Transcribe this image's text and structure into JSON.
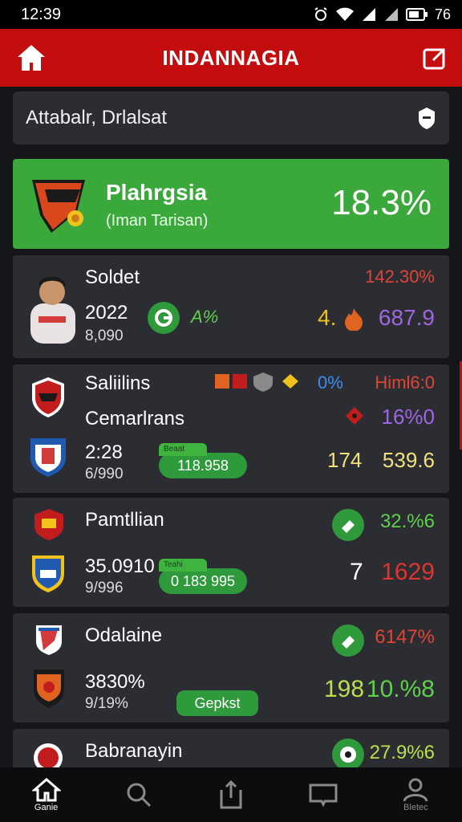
{
  "status_bar": {
    "time": "12:39",
    "battery": "76"
  },
  "app_bar": {
    "title": "INDANNAGIA"
  },
  "search": {
    "text": "Attabalr, Drlalsat"
  },
  "featured": {
    "name": "Plahrgsia",
    "subtitle": "(Iman Tarisan)",
    "percent": "18.3%"
  },
  "cards": [
    {
      "name": "Soldet",
      "top_right": "142.30%",
      "value": "2022",
      "sub": "8,090",
      "mid_label": "A%",
      "right_a": "4.",
      "right_b": "687.9",
      "colors": {
        "top_right": "#e04535",
        "right_a": "#f2c21c",
        "right_b": "#a066e0"
      }
    },
    {
      "name": "Saliilins",
      "name2": "Cemarlrans",
      "top_pct": "0%",
      "top_right": "Himl6:0",
      "mid_right": "16%0",
      "value": "2:28",
      "sub": "6/990",
      "pill": "118.958",
      "pill_tab": "Beaat",
      "right_a": "174",
      "right_b": "539.6",
      "colors": {
        "top_pct": "#3a8ef0",
        "top_right": "#e04535",
        "mid_right": "#a066e0",
        "right_a": "#f2e17a",
        "right_b": "#f2e17a"
      }
    },
    {
      "name": "Pamtllian",
      "top_right": "32.%6",
      "value": "35.0910",
      "sub": "9/996",
      "pill": "0 183 995",
      "pill_tab": "Teahi",
      "right_a": "7",
      "right_b": "1629",
      "colors": {
        "top_right": "#5fd04a",
        "right_a": "#ffffff",
        "right_b": "#e0342e"
      }
    },
    {
      "name": "Odalaine",
      "top_right": "6147%",
      "value": "3830%",
      "sub": "9/19%",
      "pill": "Gepkst",
      "right_a": "198",
      "right_b": "10.%8",
      "colors": {
        "top_right": "#e04535",
        "right_a": "#b9e04a",
        "right_b": "#5fd04a"
      }
    },
    {
      "name": "Babranayin",
      "top_right": "27.9%6",
      "colors": {
        "top_right": "#b9e04a"
      }
    }
  ],
  "bottom_nav": [
    {
      "label": "Ganie",
      "icon": "home-icon"
    },
    {
      "label": "",
      "icon": "search-icon"
    },
    {
      "label": "",
      "icon": "share-icon"
    },
    {
      "label": "",
      "icon": "book-icon"
    },
    {
      "label": "Bletec",
      "icon": "profile-icon"
    }
  ],
  "theme": {
    "accent": "#c40d0e",
    "green": "#3aa83a",
    "card": "#2b2d33",
    "background": "#151619"
  }
}
